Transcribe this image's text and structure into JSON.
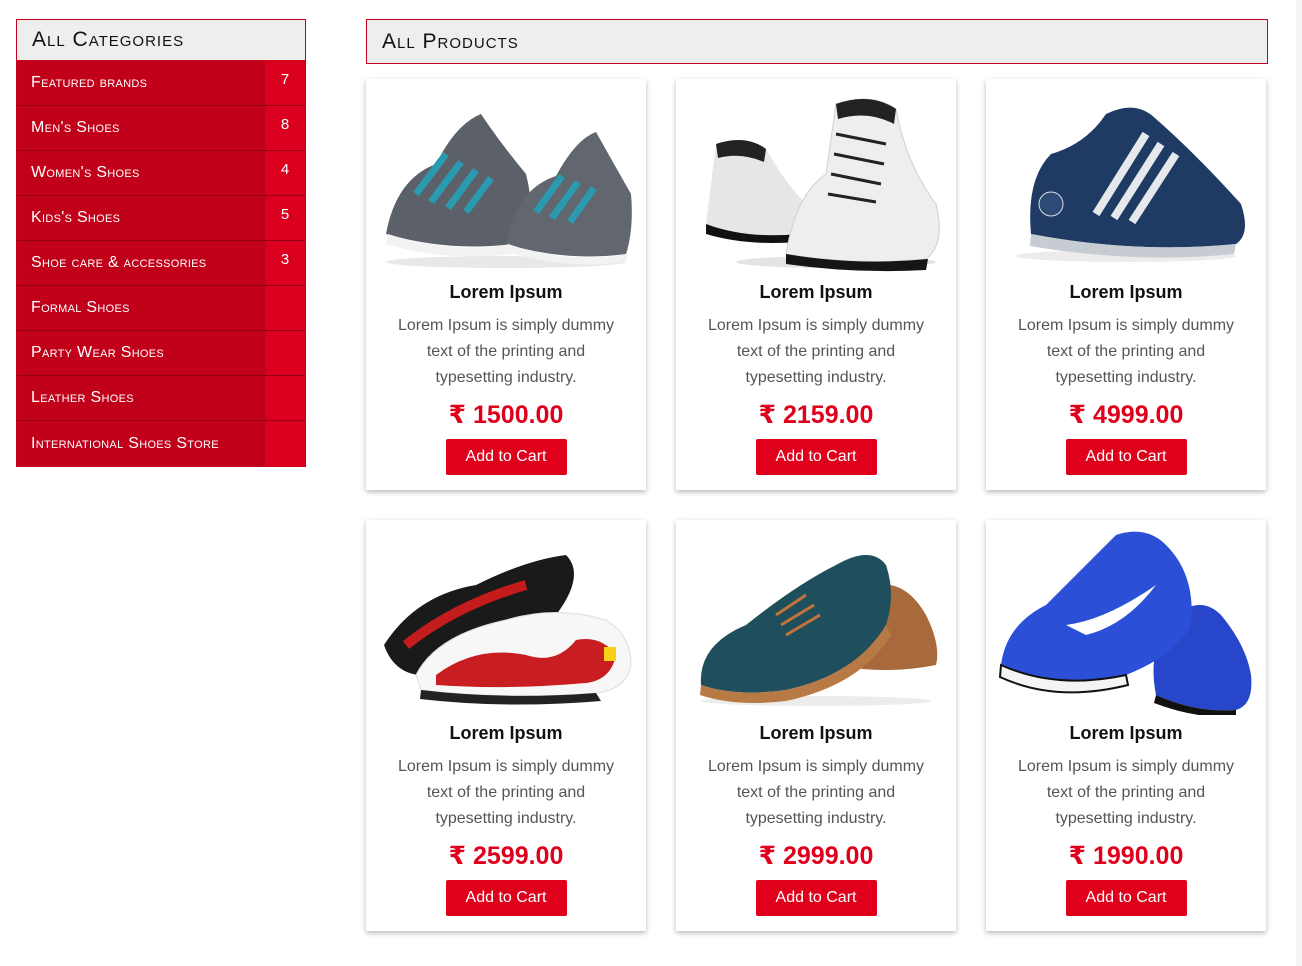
{
  "sidebar": {
    "title": "All Categories",
    "items": [
      {
        "label": "Featured brands",
        "count": "7"
      },
      {
        "label": "Men's Shoes",
        "count": "8"
      },
      {
        "label": "Women's Shoes",
        "count": "4"
      },
      {
        "label": "Kids's Shoes",
        "count": "5"
      },
      {
        "label": "Shoe care & accessories",
        "count": "3"
      },
      {
        "label": "Formal Shoes",
        "count": ""
      },
      {
        "label": "Party Wear Shoes",
        "count": ""
      },
      {
        "label": "Leather Shoes",
        "count": ""
      },
      {
        "label": "International Shoes Store",
        "count": ""
      }
    ]
  },
  "main": {
    "title": "All Products",
    "products": [
      {
        "name": "Lorem Ipsum",
        "description": "Lorem Ipsum is simply dummy text of the printing and typesetting industry.",
        "price": "₹ 1500.00",
        "button": "Add to Cart",
        "image_icon": "grey-teal-running-shoe-image"
      },
      {
        "name": "Lorem Ipsum",
        "description": "Lorem Ipsum is simply dummy text of the printing and typesetting industry.",
        "price": "₹ 2159.00",
        "button": "Add to Cart",
        "image_icon": "white-high-top-boot-image"
      },
      {
        "name": "Lorem Ipsum",
        "description": "Lorem Ipsum is simply dummy text of the printing and typesetting industry.",
        "price": "₹ 4999.00",
        "button": "Add to Cart",
        "image_icon": "navy-sneaker-image"
      },
      {
        "name": "Lorem Ipsum",
        "description": "Lorem Ipsum is simply dummy text of the printing and typesetting industry.",
        "price": "₹ 2599.00",
        "button": "Add to Cart",
        "image_icon": "red-white-racing-shoe-image"
      },
      {
        "name": "Lorem Ipsum",
        "description": "Lorem Ipsum is simply dummy text of the printing and typesetting industry.",
        "price": "₹ 2999.00",
        "button": "Add to Cart",
        "image_icon": "teal-suede-loafer-image"
      },
      {
        "name": "Lorem Ipsum",
        "description": "Lorem Ipsum is simply dummy text of the printing and typesetting industry.",
        "price": "₹ 1990.00",
        "button": "Add to Cart",
        "image_icon": "blue-sport-shoe-image"
      }
    ]
  },
  "colors": {
    "accent": "#e0001c",
    "sidebar_bg": "#c10019",
    "header_bg": "#eeeeee"
  }
}
